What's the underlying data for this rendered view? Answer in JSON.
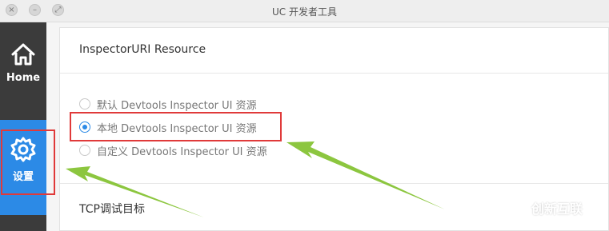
{
  "window": {
    "title": "UC 开发者工具"
  },
  "sidebar": {
    "items": [
      {
        "label": "Home",
        "icon": "home-icon"
      },
      {
        "label": "设置",
        "icon": "gear-icon",
        "active": true
      }
    ]
  },
  "main": {
    "sections": [
      {
        "title": "InspectorURI Resource",
        "options": [
          {
            "label": "默认 Devtools Inspector UI 资源",
            "checked": false
          },
          {
            "label": "本地 Devtools Inspector UI 资源",
            "checked": true
          },
          {
            "label": "自定义 Devtools Inspector UI 资源",
            "checked": false
          }
        ]
      },
      {
        "title": "TCP调试目标"
      }
    ]
  },
  "watermark": {
    "text": "创新互联"
  },
  "colors": {
    "accent": "#2c8ae6",
    "sidebar_bg": "#3b3b3b",
    "highlight": "#e03a3a",
    "arrow": "#8cc63f"
  }
}
